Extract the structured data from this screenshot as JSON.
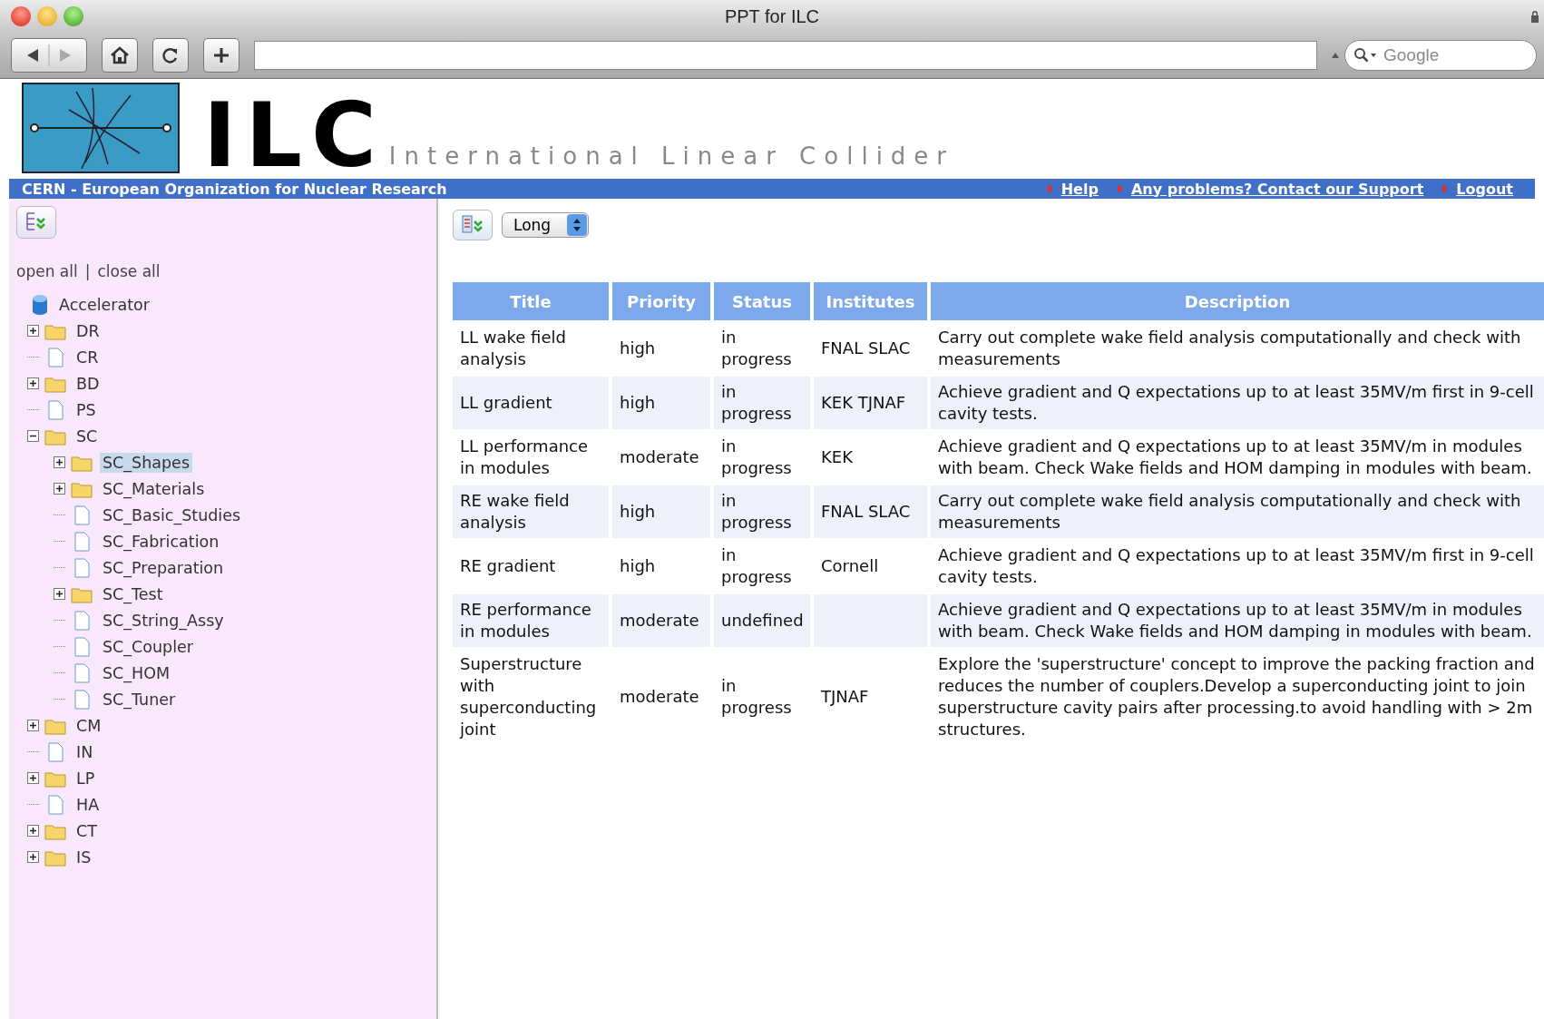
{
  "window": {
    "title": "PPT for ILC"
  },
  "browser": {
    "search_placeholder": "Google"
  },
  "header": {
    "logo_text": "ILC",
    "tagline": "International Linear Collider",
    "banner": "CERN - European Organization for Nuclear Research",
    "links": [
      "Help",
      "Any problems? Contact our Support",
      "Logout"
    ]
  },
  "sidebar": {
    "open_all": "open all",
    "separator": "|",
    "close_all": "close all",
    "tree": {
      "label": "Accelerator",
      "kind": "root",
      "selected": false,
      "children": [
        {
          "label": "DR",
          "kind": "folder",
          "expanded": false,
          "selected": false
        },
        {
          "label": "CR",
          "kind": "file",
          "selected": false
        },
        {
          "label": "BD",
          "kind": "folder",
          "expanded": false,
          "selected": false
        },
        {
          "label": "PS",
          "kind": "file",
          "selected": false
        },
        {
          "label": "SC",
          "kind": "folder",
          "expanded": true,
          "selected": false,
          "children": [
            {
              "label": "SC_Shapes",
              "kind": "folder",
              "expanded": false,
              "selected": true
            },
            {
              "label": "SC_Materials",
              "kind": "folder",
              "expanded": false,
              "selected": false
            },
            {
              "label": "SC_Basic_Studies",
              "kind": "file",
              "selected": false
            },
            {
              "label": "SC_Fabrication",
              "kind": "file",
              "selected": false
            },
            {
              "label": "SC_Preparation",
              "kind": "file",
              "selected": false
            },
            {
              "label": "SC_Test",
              "kind": "folder",
              "expanded": false,
              "selected": false
            },
            {
              "label": "SC_String_Assy",
              "kind": "file",
              "selected": false
            },
            {
              "label": "SC_Coupler",
              "kind": "file",
              "selected": false
            },
            {
              "label": "SC_HOM",
              "kind": "file",
              "selected": false
            },
            {
              "label": "SC_Tuner",
              "kind": "file",
              "selected": false
            }
          ]
        },
        {
          "label": "CM",
          "kind": "folder",
          "expanded": false,
          "selected": false
        },
        {
          "label": "IN",
          "kind": "file",
          "selected": false
        },
        {
          "label": "LP",
          "kind": "folder",
          "expanded": false,
          "selected": false
        },
        {
          "label": "HA",
          "kind": "file",
          "selected": false
        },
        {
          "label": "CT",
          "kind": "folder",
          "expanded": false,
          "selected": false
        },
        {
          "label": "IS",
          "kind": "folder",
          "expanded": false,
          "selected": false
        }
      ]
    }
  },
  "content": {
    "view_select": "Long",
    "table": {
      "columns": [
        "Title",
        "Priority",
        "Status",
        "Institutes",
        "Description"
      ],
      "rows": [
        [
          "LL wake field analysis",
          "high",
          "in progress",
          "FNAL SLAC",
          "Carry out complete wake field analysis computationally and check with measurements"
        ],
        [
          "LL gradient",
          "high",
          "in progress",
          "KEK TJNAF",
          "Achieve gradient and Q expectations up to at least 35MV/m first in 9-cell cavity tests."
        ],
        [
          "LL performance in modules",
          "moderate",
          "in progress",
          "KEK",
          "Achieve gradient and Q expectations up to at least 35MV/m in modules with beam. Check Wake fields and HOM damping in modules with beam."
        ],
        [
          "RE wake field analysis",
          "high",
          "in progress",
          "FNAL SLAC",
          "Carry out complete wake field analysis computationally and check with measurements"
        ],
        [
          "RE gradient",
          "high",
          "in progress",
          "Cornell",
          "Achieve gradient and Q expectations up to at least 35MV/m first in 9-cell cavity tests."
        ],
        [
          "RE performance in modules",
          "moderate",
          "undefined",
          "",
          "Achieve gradient and Q expectations up to at least 35MV/m in modules with beam. Check Wake fields and HOM damping in modules with beam."
        ],
        [
          "Superstructure with superconducting joint",
          "moderate",
          "in progress",
          "TJNAF",
          "Explore the 'superstructure' concept to improve the packing fraction and reduces the number of couplers.Develop a superconducting joint to join superstructure cavity pairs after processing.to avoid handling with > 2m structures."
        ]
      ]
    }
  }
}
